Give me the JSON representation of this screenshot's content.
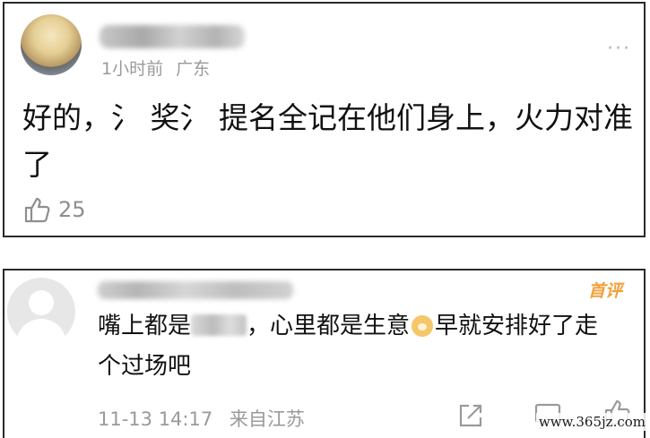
{
  "comment1": {
    "meta_time": "1小时前",
    "meta_location": "广东",
    "more_label": "···",
    "body": "好的，氵 奖氵 提名全记在他们身上，火力对准了",
    "likes": "25"
  },
  "comment2": {
    "badge": "首评",
    "body_part1": "嘴上都是",
    "body_part2": "，心里都是生意",
    "body_part3": "早就安排好了走个过场吧",
    "date": "11-13 14:17",
    "source": "来自江苏"
  },
  "watermark": "www.365jz.com",
  "colors": {
    "meta_gray": "#9a9a9a",
    "badge_orange": "#f2a03a",
    "border": "#2a2a2a"
  },
  "icons": [
    "thumbs-up-icon",
    "share-icon",
    "comment-icon",
    "more-icon",
    "dog-emoji-icon"
  ]
}
